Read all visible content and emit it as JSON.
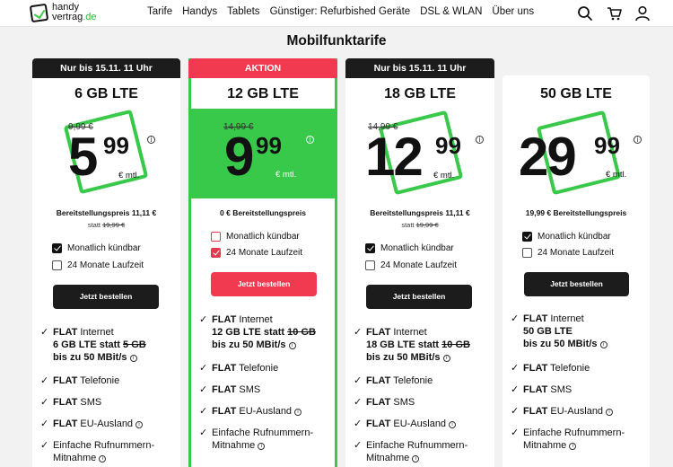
{
  "header": {
    "logo_line1": "handy",
    "logo_line2a": "vertrag",
    "logo_line2b": ".de",
    "nav": [
      "Tarife",
      "Handys",
      "Tablets",
      "Günstiger: Refurbished Geräte",
      "DSL & WLAN",
      "Über uns"
    ],
    "icons": [
      "search-icon",
      "cart-icon",
      "user-icon"
    ]
  },
  "page_title": "Mobilfunktarife",
  "colors": {
    "accent_green": "#39c94a",
    "accent_red": "#f1394f",
    "dark": "#1c1c1c"
  },
  "cards": [
    {
      "banner": "Nur bis 15.11. 11 Uhr",
      "name": "6 GB LTE",
      "old_price": "9,99 €",
      "price_main": "5",
      "price_cents": "99",
      "mtl": "€ mtl.",
      "setup": "Bereitstellungspreis 11,11 €",
      "setup_old_prefix": "statt ",
      "setup_old": "19,99 €",
      "opt1": "Monatlich kündbar",
      "opt2": "24 Monate Laufzeit",
      "opt1_checked": true,
      "button": "Jetzt bestellen",
      "f1_a": "FLAT",
      "f1_b": " Internet",
      "f1_line2a": "6 GB LTE statt ",
      "f1_line2b": "5 GB",
      "f1_line3": "bis zu 50 MBit/s",
      "f2_a": "FLAT",
      "f2_b": " Telefonie",
      "f3_a": "FLAT",
      "f3_b": " SMS",
      "f4_a": "FLAT",
      "f4_b": " EU-Ausland",
      "f5_line1": "Einfache Rufnummern-",
      "f5_line2": "Mitnahme"
    },
    {
      "banner": "AKTION",
      "name": "12 GB LTE",
      "old_price": "14,99 €",
      "price_main": "9",
      "price_cents": "99",
      "mtl": "€ mtl.",
      "setup": "0 € Bereitstellungspreis",
      "opt1": "Monatlich kündbar",
      "opt2": "24 Monate Laufzeit",
      "opt2_checked": true,
      "button": "Jetzt bestellen",
      "f1_a": "FLAT",
      "f1_b": " Internet",
      "f1_line2a": "12 GB LTE statt ",
      "f1_line2b": "10 GB",
      "f1_line3": "bis zu 50 MBit/s",
      "f2_a": "FLAT",
      "f2_b": " Telefonie",
      "f3_a": "FLAT",
      "f3_b": " SMS",
      "f4_a": "FLAT",
      "f4_b": " EU-Ausland",
      "f5_line1": "Einfache Rufnummern-",
      "f5_line2": "Mitnahme"
    },
    {
      "banner": "Nur bis 15.11. 11 Uhr",
      "name": "18 GB LTE",
      "old_price": "14,99 €",
      "price_main": "12",
      "price_cents": "99",
      "mtl": "€ mtl.",
      "setup": "Bereitstellungspreis 11,11 €",
      "setup_old_prefix": "statt ",
      "setup_old": "19,99 €",
      "opt1": "Monatlich kündbar",
      "opt2": "24 Monate Laufzeit",
      "opt1_checked": true,
      "button": "Jetzt bestellen",
      "f1_a": "FLAT",
      "f1_b": " Internet",
      "f1_line2a": "18 GB LTE statt ",
      "f1_line2b": "10 GB",
      "f1_line3": "bis zu 50 MBit/s",
      "f2_a": "FLAT",
      "f2_b": " Telefonie",
      "f3_a": "FLAT",
      "f3_b": " SMS",
      "f4_a": "FLAT",
      "f4_b": " EU-Ausland",
      "f5_line1": "Einfache Rufnummern-",
      "f5_line2": "Mitnahme"
    },
    {
      "name": "50 GB LTE",
      "price_main": "29",
      "price_cents": "99",
      "mtl": "€ mtl.",
      "setup": "19,99 € Bereitstellungspreis",
      "opt1": "Monatlich kündbar",
      "opt2": "24 Monate Laufzeit",
      "opt1_checked": true,
      "button": "Jetzt bestellen",
      "f1_a": "FLAT",
      "f1_b": " Internet",
      "f1_line2a": "50 GB LTE",
      "f1_line3": "bis zu 50 MBit/s",
      "f2_a": "FLAT",
      "f2_b": " Telefonie",
      "f3_a": "FLAT",
      "f3_b": " SMS",
      "f4_a": "FLAT",
      "f4_b": " EU-Ausland",
      "f5_line1": "Einfache Rufnummern-",
      "f5_line2": "Mitnahme"
    }
  ]
}
